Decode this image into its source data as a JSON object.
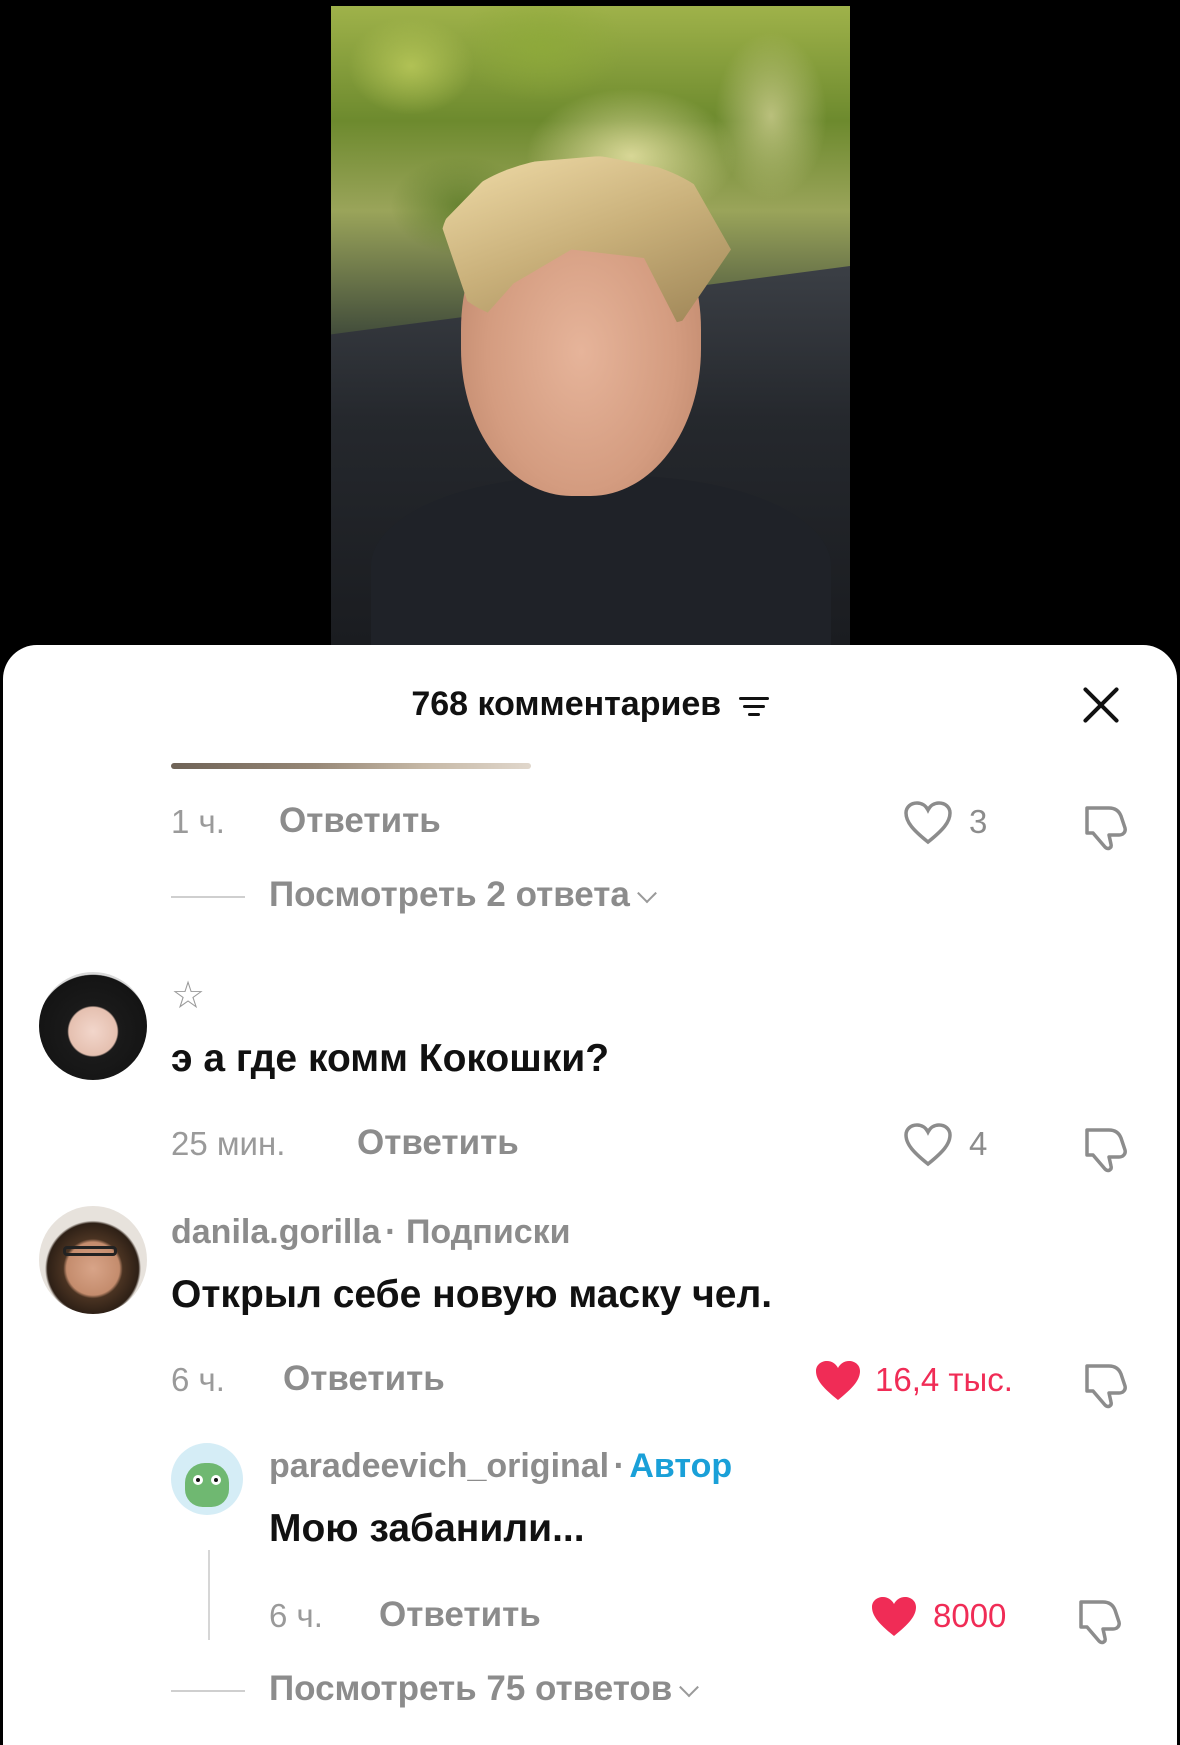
{
  "header": {
    "title": "768 комментариев"
  },
  "thread_top": {
    "time": "1 ч.",
    "reply_label": "Ответить",
    "likes": "3",
    "view_replies": "Посмотреть 2 ответа"
  },
  "comments": [
    {
      "username": "",
      "text": "э а где комм Кокошки?",
      "time": "25 мин.",
      "reply_label": "Ответить",
      "likes": "4"
    },
    {
      "username": "danila.gorilla",
      "tag": "· Подписки",
      "text": "Открыл себе новую маску чел.",
      "time": "6 ч.",
      "reply_label": "Ответить",
      "likes": "16,4 тыс."
    }
  ],
  "reply": {
    "username": "paradeevich_original",
    "separator": "·",
    "author_tag": "Автор",
    "text": "Мою забанили...",
    "time": "6 ч.",
    "reply_label": "Ответить",
    "likes": "8000"
  },
  "more": {
    "view_replies": "Посмотреть 75 ответов"
  },
  "colors": {
    "like_active": "#f02c56",
    "author": "#1aa0d8",
    "muted": "#8c8c8c"
  },
  "icons": [
    "filter-icon",
    "close-icon",
    "heart-icon",
    "dislike-icon",
    "star-icon",
    "chevron-down-icon"
  ]
}
